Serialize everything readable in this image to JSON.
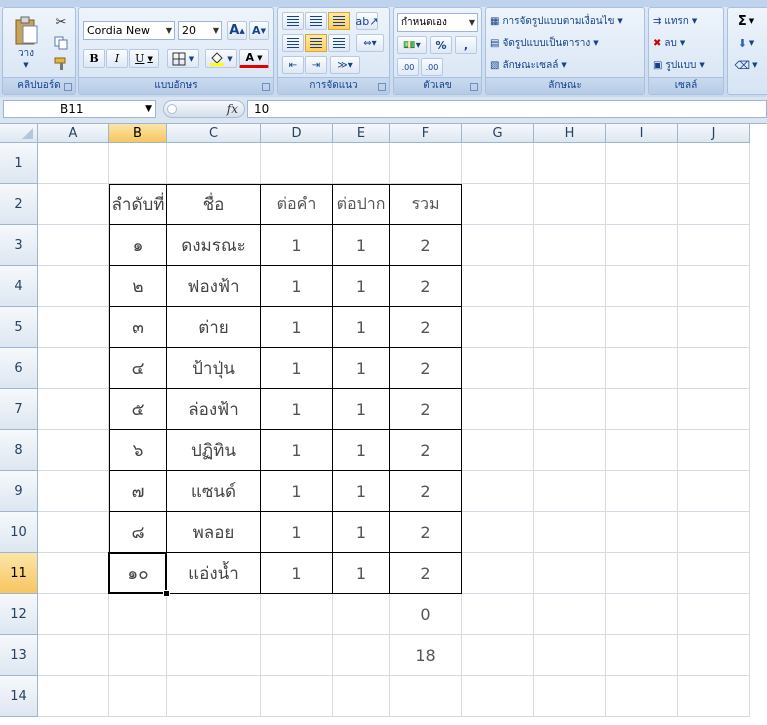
{
  "ribbon": {
    "clipboard": {
      "paste_label": "วาง",
      "group_label": "คลิปบอร์ด"
    },
    "font": {
      "font_name": "Cordia New",
      "font_size": "20",
      "bold": "B",
      "italic": "I",
      "underline": "U",
      "grow": "A",
      "shrink": "A",
      "font_color": "A",
      "group_label": "แบบอักษร"
    },
    "alignment": {
      "group_label": "การจัดแนว"
    },
    "number": {
      "format": "กำหนดเอง",
      "percent": "%",
      "comma": ",",
      "inc_decimal": ".00",
      "dec_decimal": ".00",
      "group_label": "ตัวเลข"
    },
    "styles": {
      "conditional": "การจัดรูปแบบตามเงื่อนไข",
      "as_table": "จัดรูปแบบเป็นตาราง",
      "cell_styles": "ลักษณะเซลล์",
      "group_label": "ลักษณะ"
    },
    "cells": {
      "insert": "แทรก",
      "delete": "ลบ",
      "format": "รูปแบบ",
      "group_label": "เซลล์"
    },
    "editing": {
      "sum": "Σ"
    }
  },
  "formula_bar": {
    "name_box": "B11",
    "fx": "fx",
    "formula": "10"
  },
  "columns": [
    "A",
    "B",
    "C",
    "D",
    "E",
    "F",
    "G",
    "H",
    "I",
    "J"
  ],
  "rows": [
    "1",
    "2",
    "3",
    "4",
    "5",
    "6",
    "7",
    "8",
    "9",
    "10",
    "11",
    "12",
    "13",
    "14"
  ],
  "selected": {
    "col": "B",
    "row": "11"
  },
  "table": {
    "headers": [
      "ลำดับที่",
      "ชื่อ",
      "ต่อคำ",
      "ต่อปาก",
      "รวม"
    ],
    "rows": [
      [
        "๑",
        "ดงมรณะ",
        "1",
        "1",
        "2"
      ],
      [
        "๒",
        "ฟองฟ้า",
        "1",
        "1",
        "2"
      ],
      [
        "๓",
        "ต่าย",
        "1",
        "1",
        "2"
      ],
      [
        "๔",
        "ป้าปุ่น",
        "1",
        "1",
        "2"
      ],
      [
        "๕",
        "ล่องฟ้า",
        "1",
        "1",
        "2"
      ],
      [
        "๖",
        "ปฏิทิน",
        "1",
        "1",
        "2"
      ],
      [
        "๗",
        "แซนด์",
        "1",
        "1",
        "2"
      ],
      [
        "๘",
        "พลอย",
        "1",
        "1",
        "2"
      ],
      [
        "๑๐",
        "แอ่งน้ำ",
        "1",
        "1",
        "2"
      ]
    ]
  },
  "extra_cells": {
    "F12": "0",
    "F13": "18"
  },
  "colors": {
    "ribbon_text": "#15428b",
    "header_selected": "#f7c560",
    "grid_line": "#d4dbe5",
    "table_border": "#000000"
  }
}
